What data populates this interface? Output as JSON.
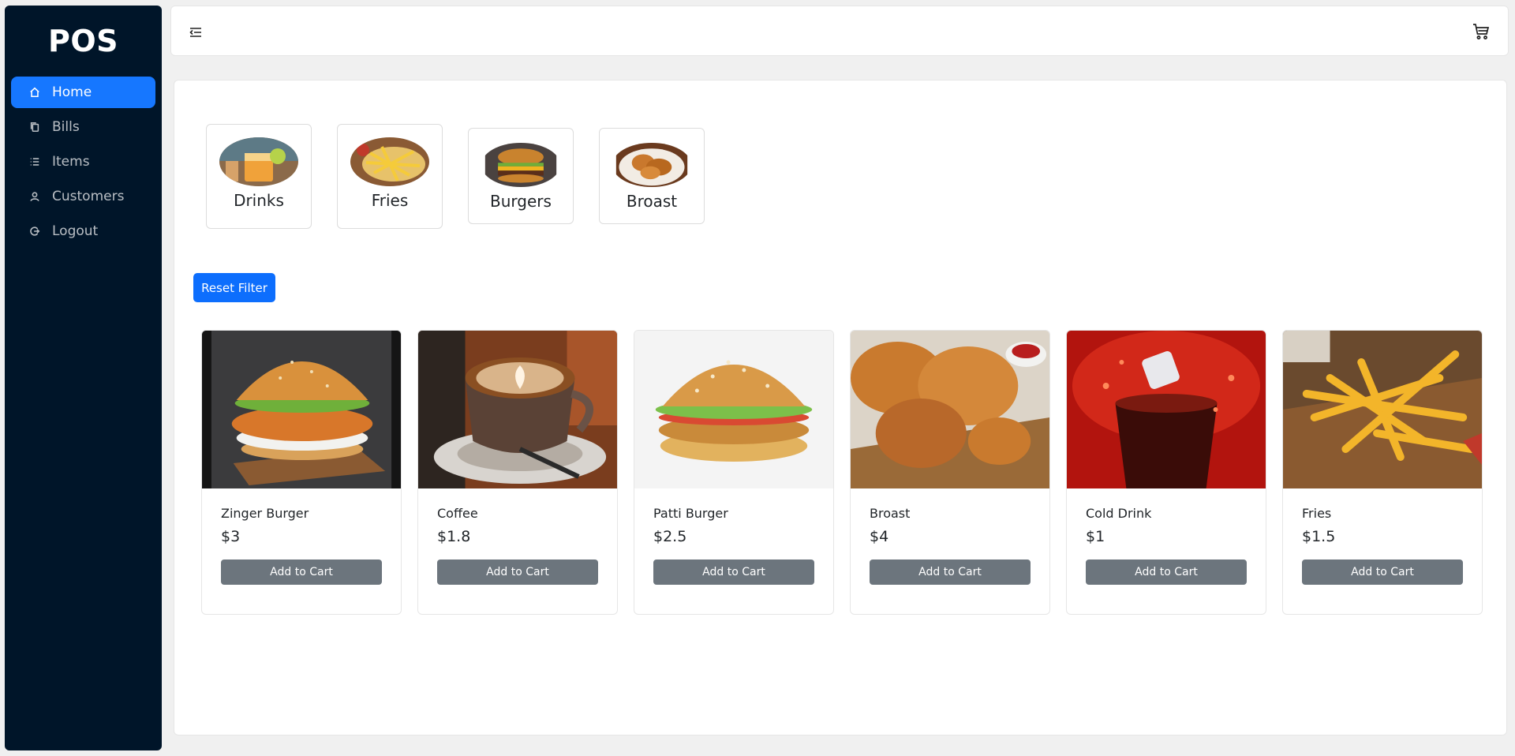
{
  "app": {
    "logo": "POS"
  },
  "sidebar": {
    "items": [
      {
        "label": "Home",
        "icon": "home-icon",
        "active": true
      },
      {
        "label": "Bills",
        "icon": "copy-icon"
      },
      {
        "label": "Items",
        "icon": "list-icon"
      },
      {
        "label": "Customers",
        "icon": "user-icon"
      },
      {
        "label": "Logout",
        "icon": "logout-icon"
      }
    ]
  },
  "header": {
    "toggle_icon": "menu-fold-icon",
    "cart_icon": "shopping-cart-icon"
  },
  "categories": [
    {
      "label": "Drinks"
    },
    {
      "label": "Fries"
    },
    {
      "label": "Burgers"
    },
    {
      "label": "Broast"
    }
  ],
  "filter": {
    "reset_label": "Reset Filter"
  },
  "products": [
    {
      "name": "Zinger Burger",
      "price": "$3",
      "button": "Add to Cart"
    },
    {
      "name": "Coffee",
      "price": "$1.8",
      "button": "Add to Cart"
    },
    {
      "name": "Patti Burger",
      "price": "$2.5",
      "button": "Add to Cart"
    },
    {
      "name": "Broast",
      "price": "$4",
      "button": "Add to Cart"
    },
    {
      "name": "Cold Drink",
      "price": "$1",
      "button": "Add to Cart"
    },
    {
      "name": "Fries",
      "price": "$1.5",
      "button": "Add to Cart"
    }
  ],
  "colors": {
    "sidebar_bg": "#001529",
    "active_item": "#1677ff",
    "primary_button": "#0d6efd",
    "secondary_button": "#6c757d"
  }
}
